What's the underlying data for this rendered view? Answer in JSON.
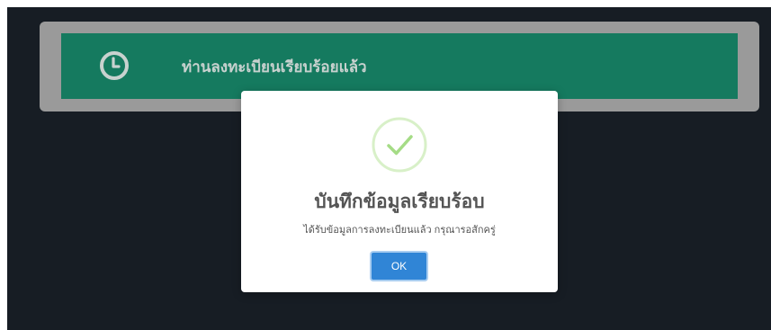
{
  "banner": {
    "icon": "clock-icon",
    "message": "ท่านลงทะเบียนเรียบร้อยแล้ว",
    "color": "#157a5f",
    "frame_color": "#9a9a9a"
  },
  "modal": {
    "icon": "success-check-icon",
    "title": "บันทึกข้อมูลเรียบร้อบ",
    "text": "ได้รับข้อมูลการลงทะเบียนแล้ว กรุณารอสักครู่",
    "ok_label": "OK",
    "ok_color": "#3085d6",
    "success_color": "#a5dc86"
  },
  "background": {
    "color": "#171d24"
  }
}
